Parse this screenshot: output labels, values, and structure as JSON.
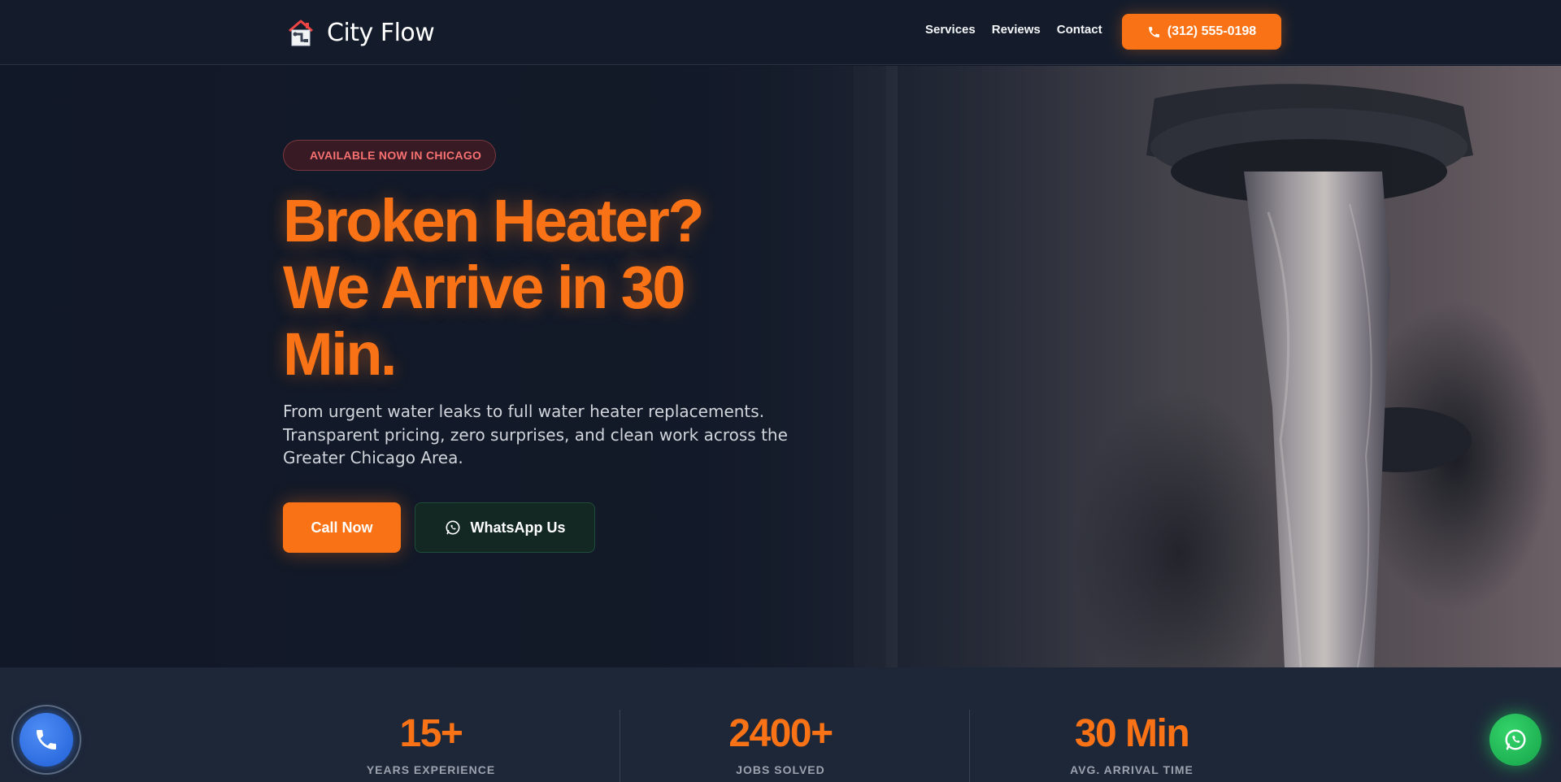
{
  "header": {
    "brand": "City Flow",
    "nav": [
      {
        "label": "Services"
      },
      {
        "label": "Reviews"
      },
      {
        "label": "Contact"
      }
    ],
    "phone_label": "(312) 555-0198"
  },
  "hero": {
    "badge": "AVAILABLE NOW IN CHICAGO",
    "title_line1": "Broken Heater?",
    "title_line2": "We Arrive in 30",
    "title_line3": "Min.",
    "subtitle": "From urgent water leaks to full water heater replacements. Transparent pricing, zero surprises, and clean work across the Greater Chicago Area.",
    "call_label": "Call Now",
    "whatsapp_label": "WhatsApp Us"
  },
  "stats": [
    {
      "value": "15+",
      "label": "YEARS EXPERIENCE"
    },
    {
      "value": "2400+",
      "label": "JOBS SOLVED"
    },
    {
      "value": "30 Min",
      "label": "AVG. ARRIVAL TIME"
    }
  ],
  "colors": {
    "accent": "#f97316",
    "background": "#111827",
    "badge_text": "#f87171",
    "whatsapp": "#22c55e",
    "phone_float": "#3b82f6"
  },
  "icons": {
    "logo": "house-pipe-icon",
    "phone": "phone-icon",
    "whatsapp": "whatsapp-icon"
  }
}
